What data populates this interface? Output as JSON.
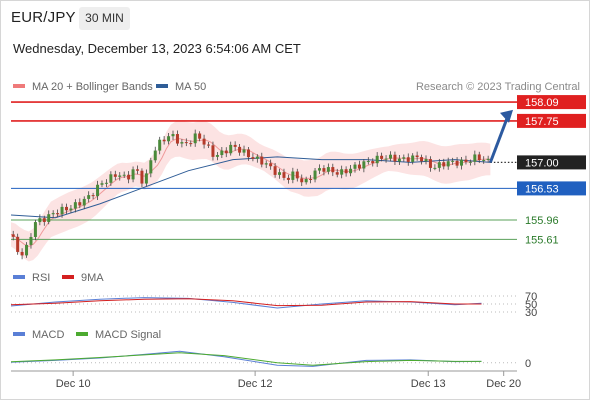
{
  "header": {
    "symbol": "EUR/JPY",
    "timeframe": "30 MIN",
    "datetime": "Wednesday, December 13, 2023 6:54:06 AM CET"
  },
  "chart_data": [
    {
      "type": "candlestick",
      "legend": [
        {
          "label": "MA 20 + Bollinger Bands",
          "color": "#ef7a7a"
        },
        {
          "label": "MA 50",
          "color": "#2f5d97"
        }
      ],
      "credit": "Research © 2023 Trading Central",
      "ylim": [
        155.2,
        158.2
      ],
      "levels": [
        {
          "value": 158.09,
          "label": "158.09",
          "color": "#e02020"
        },
        {
          "value": 157.75,
          "label": "157.75",
          "color": "#e02020"
        },
        {
          "value": 156.53,
          "label": "156.53",
          "color": "#2060c0"
        },
        {
          "value": 155.96,
          "label": "155.96",
          "color": "#5aa05a"
        },
        {
          "value": 155.61,
          "label": "155.61",
          "color": "#5aa05a"
        }
      ],
      "last_price": {
        "value": 157.0,
        "label": "157.00"
      },
      "forecast_arrow": {
        "from": 157.0,
        "to": 157.95
      },
      "price_path": [
        [
          0,
          155.7
        ],
        [
          2,
          155.3
        ],
        [
          4,
          155.5
        ],
        [
          5,
          155.9
        ],
        [
          8,
          156.0
        ],
        [
          10,
          156.1
        ],
        [
          14,
          156.2
        ],
        [
          18,
          156.4
        ],
        [
          20,
          156.6
        ],
        [
          24,
          156.8
        ],
        [
          26,
          156.7
        ],
        [
          28,
          156.9
        ],
        [
          30,
          156.6
        ],
        [
          32,
          157.2
        ],
        [
          34,
          157.4
        ],
        [
          36,
          157.5
        ],
        [
          39,
          157.3
        ],
        [
          42,
          157.5
        ],
        [
          44,
          157.3
        ],
        [
          46,
          157.1
        ],
        [
          48,
          157.2
        ],
        [
          50,
          157.3
        ],
        [
          54,
          157.1
        ],
        [
          57,
          157.0
        ],
        [
          60,
          156.8
        ],
        [
          62,
          156.7
        ],
        [
          64,
          156.8
        ],
        [
          66,
          156.6
        ],
        [
          68,
          156.8
        ],
        [
          70,
          156.9
        ],
        [
          74,
          156.8
        ],
        [
          77,
          156.9
        ],
        [
          80,
          157.0
        ],
        [
          84,
          157.1
        ],
        [
          88,
          157.05
        ],
        [
          92,
          157.1
        ],
        [
          95,
          156.9
        ],
        [
          98,
          157.0
        ],
        [
          102,
          157.0
        ],
        [
          105,
          157.1
        ],
        [
          108,
          157.0
        ]
      ],
      "ma50_path": [
        [
          0,
          156.05
        ],
        [
          10,
          156.0
        ],
        [
          20,
          156.25
        ],
        [
          30,
          156.55
        ],
        [
          40,
          156.85
        ],
        [
          50,
          157.05
        ],
        [
          60,
          157.1
        ],
        [
          70,
          157.05
        ],
        [
          80,
          157.05
        ],
        [
          90,
          157.0
        ],
        [
          100,
          157.05
        ],
        [
          108,
          157.0
        ]
      ],
      "x_tick_labels": [
        {
          "x": 14,
          "label": "Dec 10"
        },
        {
          "x": 55,
          "label": "Dec 12"
        },
        {
          "x": 94,
          "label": "Dec 13"
        },
        {
          "x": 111,
          "label": "Dec 20"
        }
      ],
      "xlim": [
        0,
        114
      ]
    },
    {
      "type": "line",
      "series": [
        {
          "name": "RSI",
          "color": "#5a7fd6",
          "values": [
            [
              0,
              45
            ],
            [
              10,
              55
            ],
            [
              20,
              62
            ],
            [
              30,
              66
            ],
            [
              40,
              64
            ],
            [
              50,
              54
            ],
            [
              60,
              40
            ],
            [
              70,
              50
            ],
            [
              80,
              58
            ],
            [
              90,
              55
            ],
            [
              100,
              48
            ],
            [
              106,
              52
            ]
          ]
        },
        {
          "name": "9MA",
          "color": "#d42020",
          "values": [
            [
              0,
              48
            ],
            [
              10,
              52
            ],
            [
              20,
              58
            ],
            [
              30,
              62
            ],
            [
              40,
              63
            ],
            [
              50,
              58
            ],
            [
              60,
              46
            ],
            [
              70,
              47
            ],
            [
              80,
              55
            ],
            [
              90,
              56
            ],
            [
              100,
              50
            ],
            [
              106,
              50
            ]
          ]
        }
      ],
      "y_ticks": [
        "70",
        "50",
        "30"
      ],
      "ylim": [
        20,
        80
      ]
    },
    {
      "type": "line",
      "series": [
        {
          "name": "MACD",
          "color": "#5a7fd6",
          "values": [
            [
              0,
              0.02
            ],
            [
              10,
              0.1
            ],
            [
              20,
              0.2
            ],
            [
              30,
              0.35
            ],
            [
              38,
              0.48
            ],
            [
              48,
              0.25
            ],
            [
              60,
              -0.1
            ],
            [
              68,
              -0.15
            ],
            [
              80,
              0.1
            ],
            [
              90,
              0.12
            ],
            [
              100,
              0.05
            ],
            [
              106,
              0.06
            ]
          ]
        },
        {
          "name": "MACD Signal",
          "color": "#4caa30",
          "values": [
            [
              0,
              0.04
            ],
            [
              10,
              0.12
            ],
            [
              20,
              0.22
            ],
            [
              30,
              0.33
            ],
            [
              38,
              0.42
            ],
            [
              48,
              0.3
            ],
            [
              60,
              0.0
            ],
            [
              68,
              -0.1
            ],
            [
              80,
              0.05
            ],
            [
              90,
              0.1
            ],
            [
              100,
              0.06
            ],
            [
              106,
              0.06
            ]
          ]
        }
      ],
      "y_ticks": [
        "0"
      ],
      "ylim": [
        -0.3,
        0.7
      ]
    }
  ]
}
